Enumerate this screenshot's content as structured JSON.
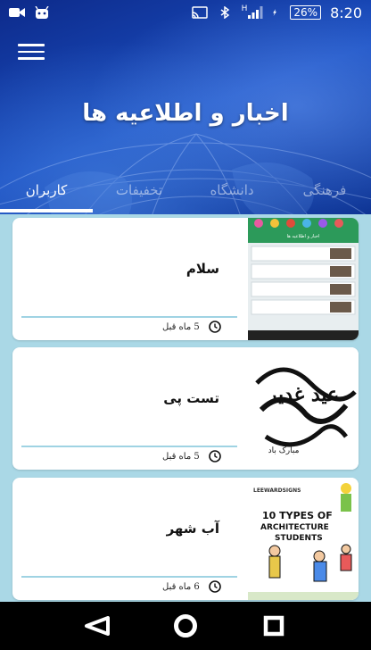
{
  "status_bar": {
    "battery": "26%",
    "time": "8:20",
    "network_type": "H",
    "icons": [
      "video-camera-icon",
      "android-icon",
      "cast-icon",
      "bluetooth-icon",
      "signal-icon",
      "charging-icon",
      "battery-icon"
    ]
  },
  "header": {
    "title": "اخبار و اطلاعیه ها",
    "menu_icon": "hamburger-menu-icon"
  },
  "tabs": [
    {
      "label": "کاربران",
      "active": true
    },
    {
      "label": "تخفیفات",
      "active": false
    },
    {
      "label": "دانشگاه",
      "active": false
    },
    {
      "label": "فرهنگی",
      "active": false
    }
  ],
  "cards": [
    {
      "title": "سلام",
      "time": "5 ماه قبل",
      "thumb": "app-screenshot"
    },
    {
      "title": "تست پی",
      "time": "5 ماه قبل",
      "thumb": "calligraphy"
    },
    {
      "title": "آب شهر",
      "time": "6 ماه قبل",
      "thumb": "architecture-students"
    }
  ],
  "thumb_text": {
    "calligraphy_main": "عید غدیر",
    "calligraphy_sub": "مبارک باد",
    "arch_brand": "LEEWARDSIGNS",
    "arch_title_1": "10 TYPES OF",
    "arch_title_2": "ARCHITECTURE",
    "arch_title_3": "STUDENTS",
    "app_header": "اخبار و اطلاعیه ها"
  },
  "nav": {
    "back_icon": "back-triangle-icon",
    "home_icon": "home-circle-icon",
    "recents_icon": "recents-square-icon"
  },
  "colors": {
    "header_blue": "#1a4fc2",
    "list_bg": "#aad8e6",
    "divider": "#9fd3e3"
  }
}
